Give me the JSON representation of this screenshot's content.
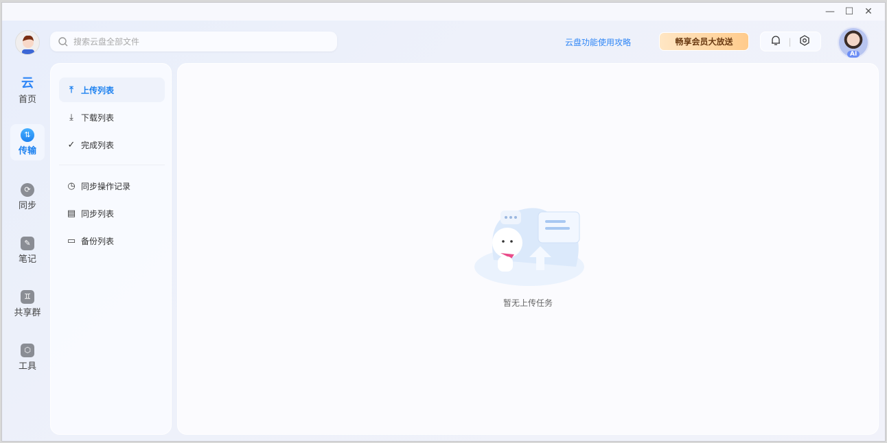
{
  "window": {
    "minimize": "—",
    "maximize": "☐",
    "close": "✕"
  },
  "header": {
    "search_placeholder": "搜索云盘全部文件",
    "guide_link": "云盘功能使用攻略",
    "vip_button": "畅享会员大放送",
    "ai_badge": "AI"
  },
  "nav": [
    {
      "label": "首页",
      "icon": "cloud-logo-icon"
    },
    {
      "label": "传输",
      "icon": "transfer-icon",
      "active": true
    },
    {
      "label": "同步",
      "icon": "sync-icon"
    },
    {
      "label": "笔记",
      "icon": "note-icon"
    },
    {
      "label": "共享群",
      "icon": "group-icon"
    },
    {
      "label": "工具",
      "icon": "toolbox-icon"
    }
  ],
  "sidebar": {
    "items": [
      {
        "label": "上传列表",
        "icon": "upload-icon",
        "active": true
      },
      {
        "label": "下载列表",
        "icon": "download-icon"
      },
      {
        "label": "完成列表",
        "icon": "check-circle-icon"
      },
      {
        "label": "同步操作记录",
        "icon": "history-icon"
      },
      {
        "label": "同步列表",
        "icon": "sync-list-icon"
      },
      {
        "label": "备份列表",
        "icon": "backup-folder-icon"
      }
    ]
  },
  "main": {
    "empty_text": "暂无上传任务"
  }
}
